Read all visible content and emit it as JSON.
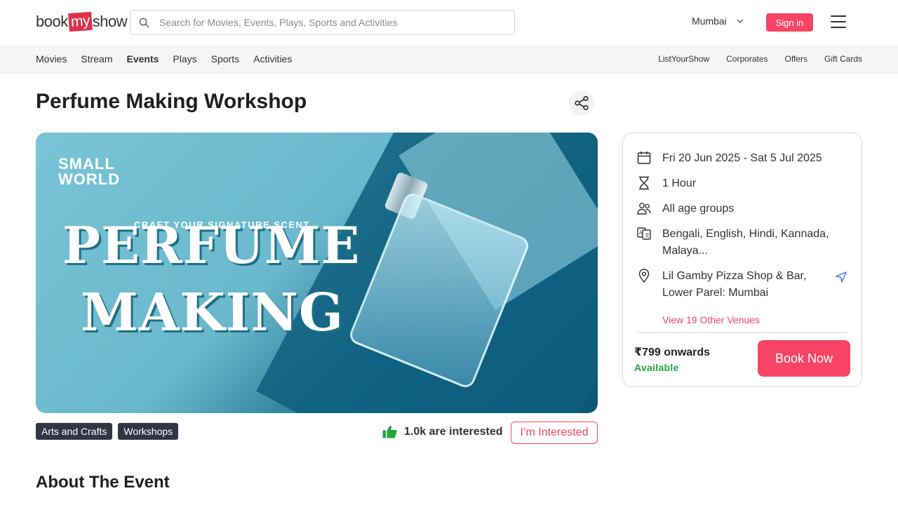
{
  "header": {
    "logo_left": "book",
    "logo_mid": "my",
    "logo_right": "show",
    "search_placeholder": "Search for Movies, Events, Plays, Sports and Activities",
    "city": "Mumbai",
    "signin_label": "Sign in"
  },
  "nav": {
    "left": [
      "Movies",
      "Stream",
      "Events",
      "Plays",
      "Sports",
      "Activities"
    ],
    "right": [
      "ListYourShow",
      "Corporates",
      "Offers",
      "Gift Cards"
    ]
  },
  "event": {
    "title": "Perfume Making Workshop",
    "banner": {
      "brand_line1": "SMALL",
      "brand_line2": "WORLD",
      "tagline": "CRAFT YOUR SIGNATURE SCENT",
      "headline1": "PERFUME",
      "headline2": "MAKING"
    },
    "tags": [
      "Arts and Crafts",
      "Workshops"
    ],
    "interested_count": "1.0k are interested",
    "interested_button": "I’m Interested"
  },
  "details": {
    "dates": "Fri 20 Jun 2025 - Sat 5 Jul 2025",
    "duration": "1 Hour",
    "age": "All age groups",
    "languages_line1": "Bengali, English, Hindi, Kannada,",
    "languages_line2": "Malaya...",
    "venue_line1": "Lil Gamby Pizza Shop & Bar,",
    "venue_line2": "Lower Parel: Mumbai",
    "other_venues": "View 19 Other Venues",
    "price": "₹799 onwards",
    "availability": "Available",
    "book_label": "Book Now"
  },
  "about_heading": "About The Event",
  "colors": {
    "accent": "#f84464",
    "tag_bg": "#333545",
    "available": "#1ea83c",
    "thumb": "#1ea83c"
  }
}
